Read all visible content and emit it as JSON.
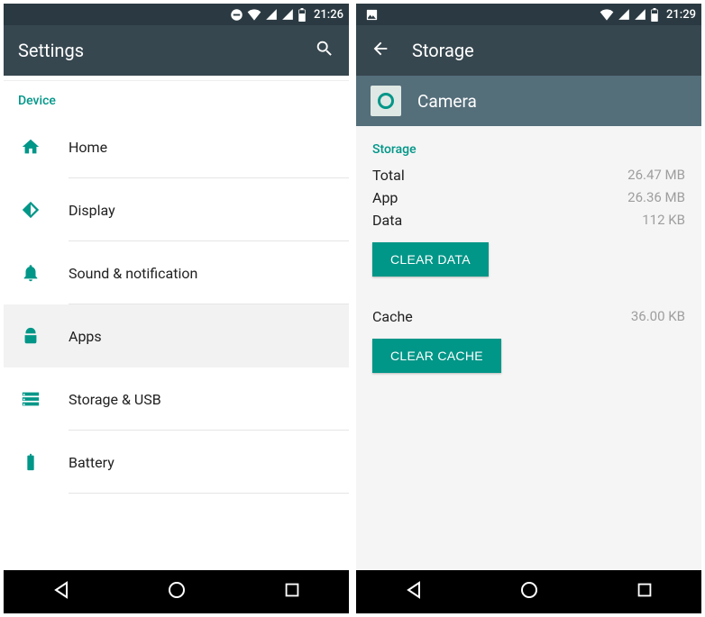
{
  "left": {
    "status_time": "21:26",
    "title": "Settings",
    "section": "Device",
    "items": [
      {
        "label": "Home"
      },
      {
        "label": "Display"
      },
      {
        "label": "Sound & notification"
      },
      {
        "label": "Apps"
      },
      {
        "label": "Storage & USB"
      },
      {
        "label": "Battery"
      }
    ]
  },
  "right": {
    "status_time": "21:29",
    "title": "Storage",
    "app_name": "Camera",
    "section": "Storage",
    "rows": {
      "total_label": "Total",
      "total_value": "26.47 MB",
      "app_label": "App",
      "app_value": "26.36 MB",
      "data_label": "Data",
      "data_value": "112 KB",
      "cache_label": "Cache",
      "cache_value": "36.00 KB"
    },
    "clear_data_label": "CLEAR DATA",
    "clear_cache_label": "CLEAR CACHE"
  }
}
